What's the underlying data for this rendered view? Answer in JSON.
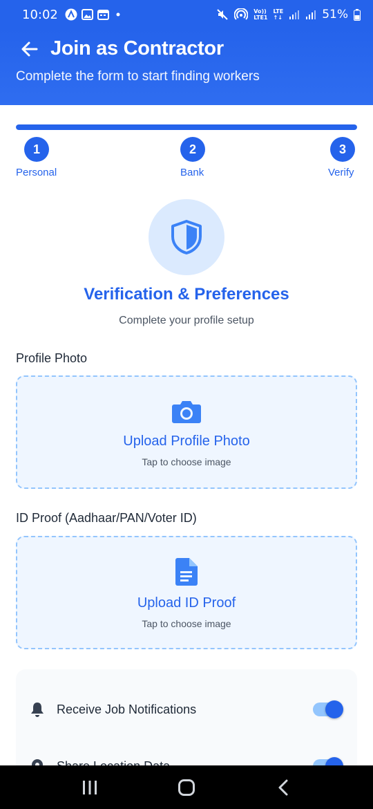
{
  "status_bar": {
    "time": "10:02",
    "left_icons": [
      "app-a-icon",
      "gallery-icon",
      "calendar-icon",
      "dot-icon"
    ],
    "right_icons": [
      "mute-icon",
      "hotspot-icon",
      "volte-icon",
      "signal-icon",
      "signal-r-icon"
    ],
    "volte_top": "Vo))",
    "volte_bottom": "LTE1",
    "lte_top": "LTE",
    "lte_bottom": "↑↓",
    "battery": "51%"
  },
  "header": {
    "title": "Join as Contractor",
    "subtitle": "Complete the form to start finding workers",
    "back_icon": "arrow-left-icon"
  },
  "progress": {
    "fraction": 1.0,
    "steps": [
      {
        "number": "1",
        "label": "Personal"
      },
      {
        "number": "2",
        "label": "Bank"
      },
      {
        "number": "3",
        "label": "Verify"
      }
    ]
  },
  "hero": {
    "icon": "shield-icon",
    "title": "Verification & Preferences",
    "subtitle": "Complete your profile setup"
  },
  "profile_photo": {
    "label": "Profile Photo",
    "icon": "camera-icon",
    "title": "Upload Profile Photo",
    "hint": "Tap to choose image"
  },
  "id_proof": {
    "label": "ID Proof (Aadhaar/PAN/Voter ID)",
    "icon": "document-icon",
    "title": "Upload ID Proof",
    "hint": "Tap to choose image"
  },
  "preferences": {
    "items": [
      {
        "icon": "bell-icon",
        "label": "Receive Job Notifications",
        "enabled": true
      },
      {
        "icon": "location-icon",
        "label": "Share Location Data",
        "enabled": true
      }
    ]
  },
  "colors": {
    "primary": "#2563eb",
    "light": "#dbeafe",
    "dashed": "#93c5fd"
  },
  "nav": [
    "recents-icon",
    "home-icon",
    "back-icon"
  ]
}
